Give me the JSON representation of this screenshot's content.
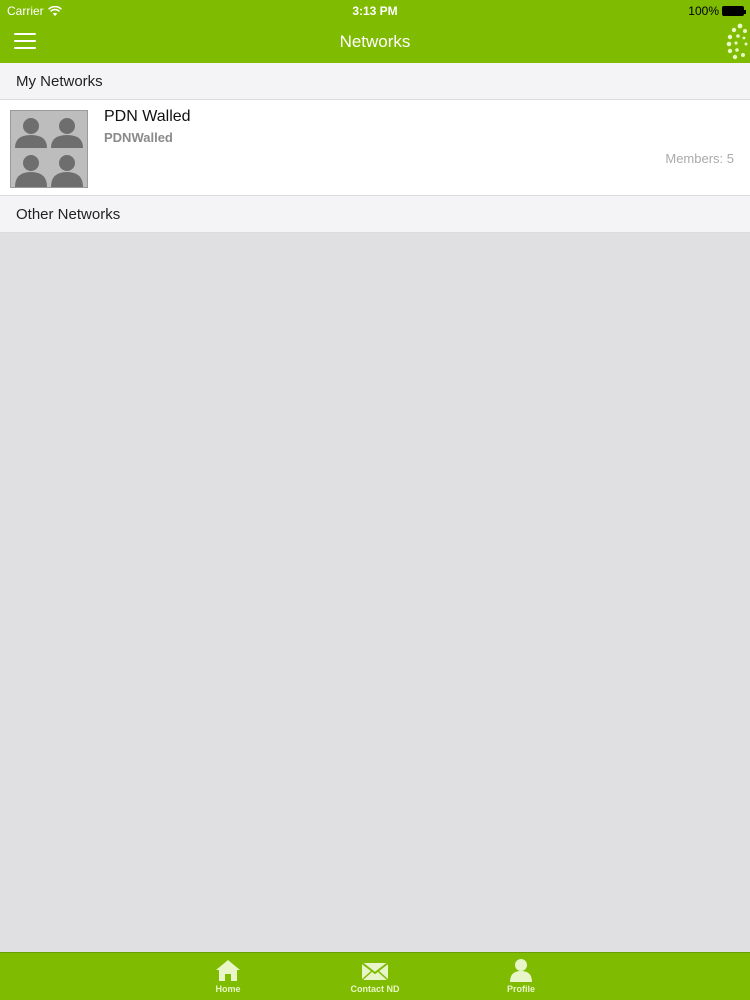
{
  "status_bar": {
    "carrier": "Carrier",
    "time": "3:13 PM",
    "battery_pct": "100%"
  },
  "nav": {
    "title": "Networks",
    "menu_icon": "hamburger-menu-icon",
    "logo_icon": "sunburst-logo-icon"
  },
  "sections": {
    "my_networks": "My Networks",
    "other_networks": "Other Networks"
  },
  "my_networks": [
    {
      "name": "PDN Walled",
      "handle": "PDNWalled",
      "members": "Members: 5",
      "icon": "group-avatar-icon"
    }
  ],
  "tabs": [
    {
      "label": "Home",
      "icon": "home-icon"
    },
    {
      "label": "Contact ND",
      "icon": "mail-icon"
    },
    {
      "label": "Profile",
      "icon": "person-icon"
    }
  ],
  "colors": {
    "brand_green": "#7fbb00",
    "background": "#e0e0e2",
    "section_header": "#f4f4f6"
  }
}
